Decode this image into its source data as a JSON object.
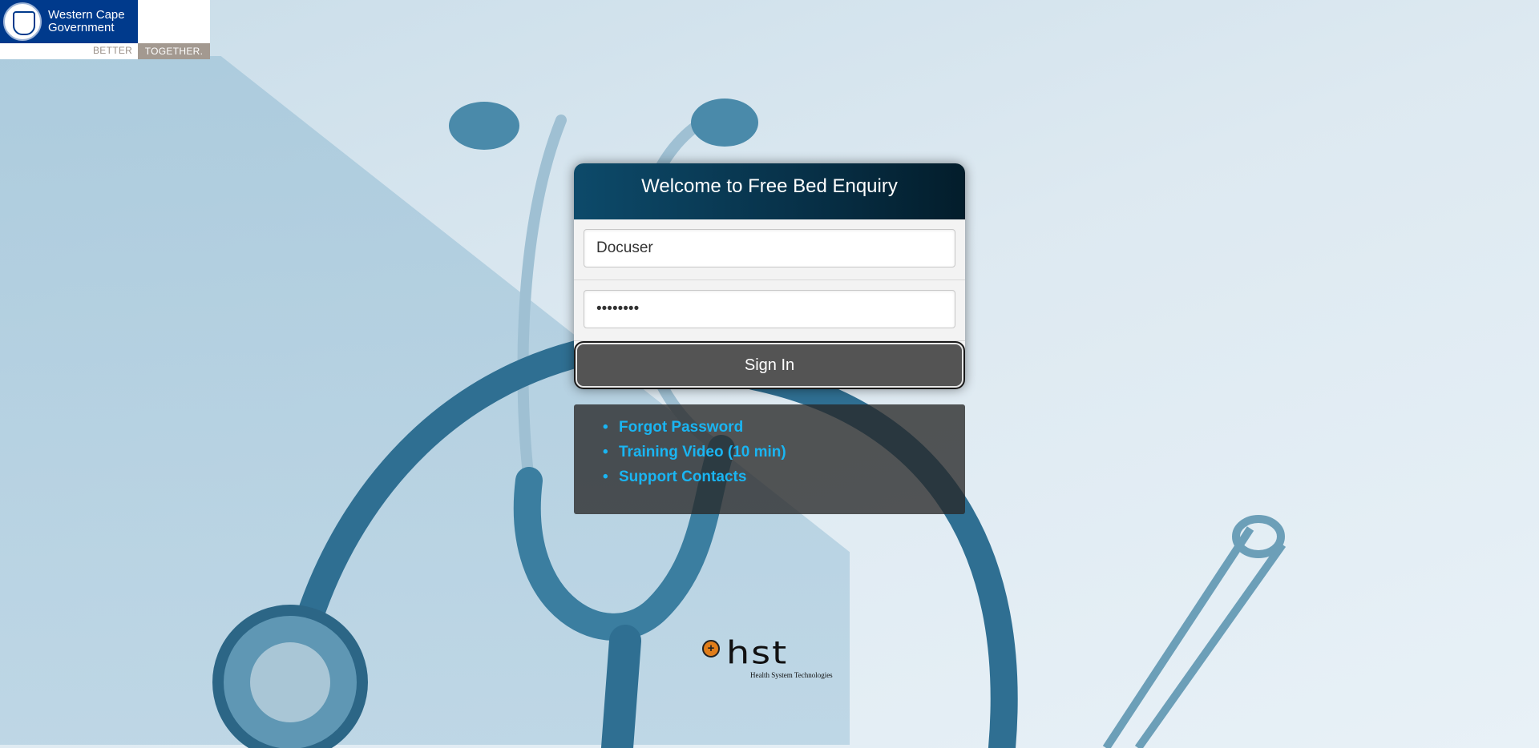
{
  "brand": {
    "org_name": "Western Cape Government",
    "slogan_better": "BETTER",
    "slogan_together": "TOGETHER."
  },
  "login": {
    "title": "Welcome to Free Bed Enquiry",
    "username_value": "Docuser",
    "password_value": "••••••••",
    "signin_label": "Sign In"
  },
  "links": [
    {
      "label": "Forgot Password"
    },
    {
      "label": "Training Video (10 min)"
    },
    {
      "label": "Support Contacts"
    }
  ],
  "footer": {
    "logo_text": "hst",
    "logo_subtitle": "Health System Technologies"
  },
  "colors": {
    "header_blue": "#073047",
    "link_blue": "#1ab5f2",
    "button_gray": "#545454",
    "accent_orange": "#e07d1a"
  }
}
